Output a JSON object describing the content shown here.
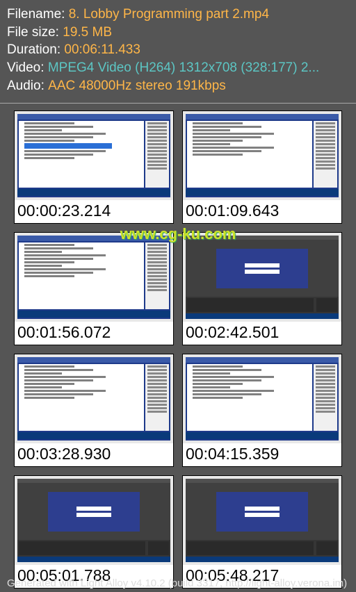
{
  "meta": {
    "filename_label": "Filename: ",
    "filename_value": "8. Lobby Programming part 2.mp4",
    "filesize_label": "File size: ",
    "filesize_value": "19.5 MB",
    "duration_label": "Duration: ",
    "duration_value": "00:06:11.433",
    "video_label": "Video: ",
    "video_value": "MPEG4 Video (H264) 1312x708 (328:177) 2...",
    "audio_label": "Audio: ",
    "audio_value": "AAC 48000Hz stereo 191kbps"
  },
  "thumbs": [
    {
      "ts": "00:00:23.214",
      "kind": "ide-hl"
    },
    {
      "ts": "00:01:09.643",
      "kind": "ide"
    },
    {
      "ts": "00:01:56.072",
      "kind": "ide"
    },
    {
      "ts": "00:02:42.501",
      "kind": "unity"
    },
    {
      "ts": "00:03:28.930",
      "kind": "ide"
    },
    {
      "ts": "00:04:15.359",
      "kind": "ide"
    },
    {
      "ts": "00:05:01.788",
      "kind": "unity"
    },
    {
      "ts": "00:05:48.217",
      "kind": "unity"
    }
  ],
  "watermark": "www.cg-ku.com",
  "footer": "Generated with Light Alloy v4.10.2 (build 3317, http://light-alloy.verona.im)"
}
